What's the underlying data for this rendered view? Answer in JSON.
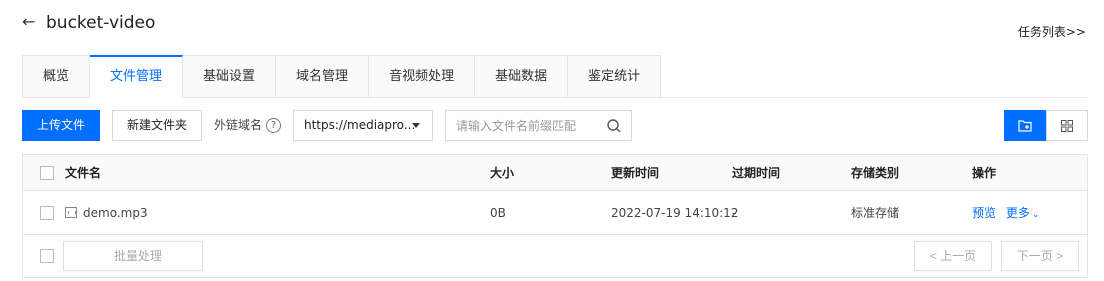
{
  "header": {
    "back_icon": "arrow-left-icon",
    "title": "bucket-video",
    "task_link": "任务列表>>"
  },
  "tabs": [
    {
      "label": "概览",
      "active": false
    },
    {
      "label": "文件管理",
      "active": true
    },
    {
      "label": "基础设置",
      "active": false
    },
    {
      "label": "域名管理",
      "active": false
    },
    {
      "label": "音视频处理",
      "active": false
    },
    {
      "label": "基础数据",
      "active": false
    },
    {
      "label": "鉴定统计",
      "active": false
    }
  ],
  "toolbar": {
    "upload_label": "上传文件",
    "new_folder_label": "新建文件夹",
    "domain_label": "外链域名",
    "help_icon": "question-circle-icon",
    "domain_value": "https://mediapro...",
    "search_placeholder": "请输入文件名前缀匹配",
    "search_icon": "search-icon",
    "view_icons": [
      "folder-add-icon",
      "grid-view-icon"
    ]
  },
  "table": {
    "columns": [
      "文件名",
      "大小",
      "更新时间",
      "过期时间",
      "存储类别",
      "操作"
    ],
    "rows": [
      {
        "name": "demo.mp3",
        "size": "0B",
        "updated": "2022-07-19 14:10:12",
        "expires": "-",
        "storage_class": "标准存储",
        "actions": {
          "preview": "预览",
          "more": "更多"
        }
      }
    ]
  },
  "footer": {
    "batch_label": "批量处理",
    "prev_label": "< 上一页",
    "next_label": "下一页 >"
  },
  "colors": {
    "accent": "#006eff",
    "border": "#e5e5e5"
  }
}
